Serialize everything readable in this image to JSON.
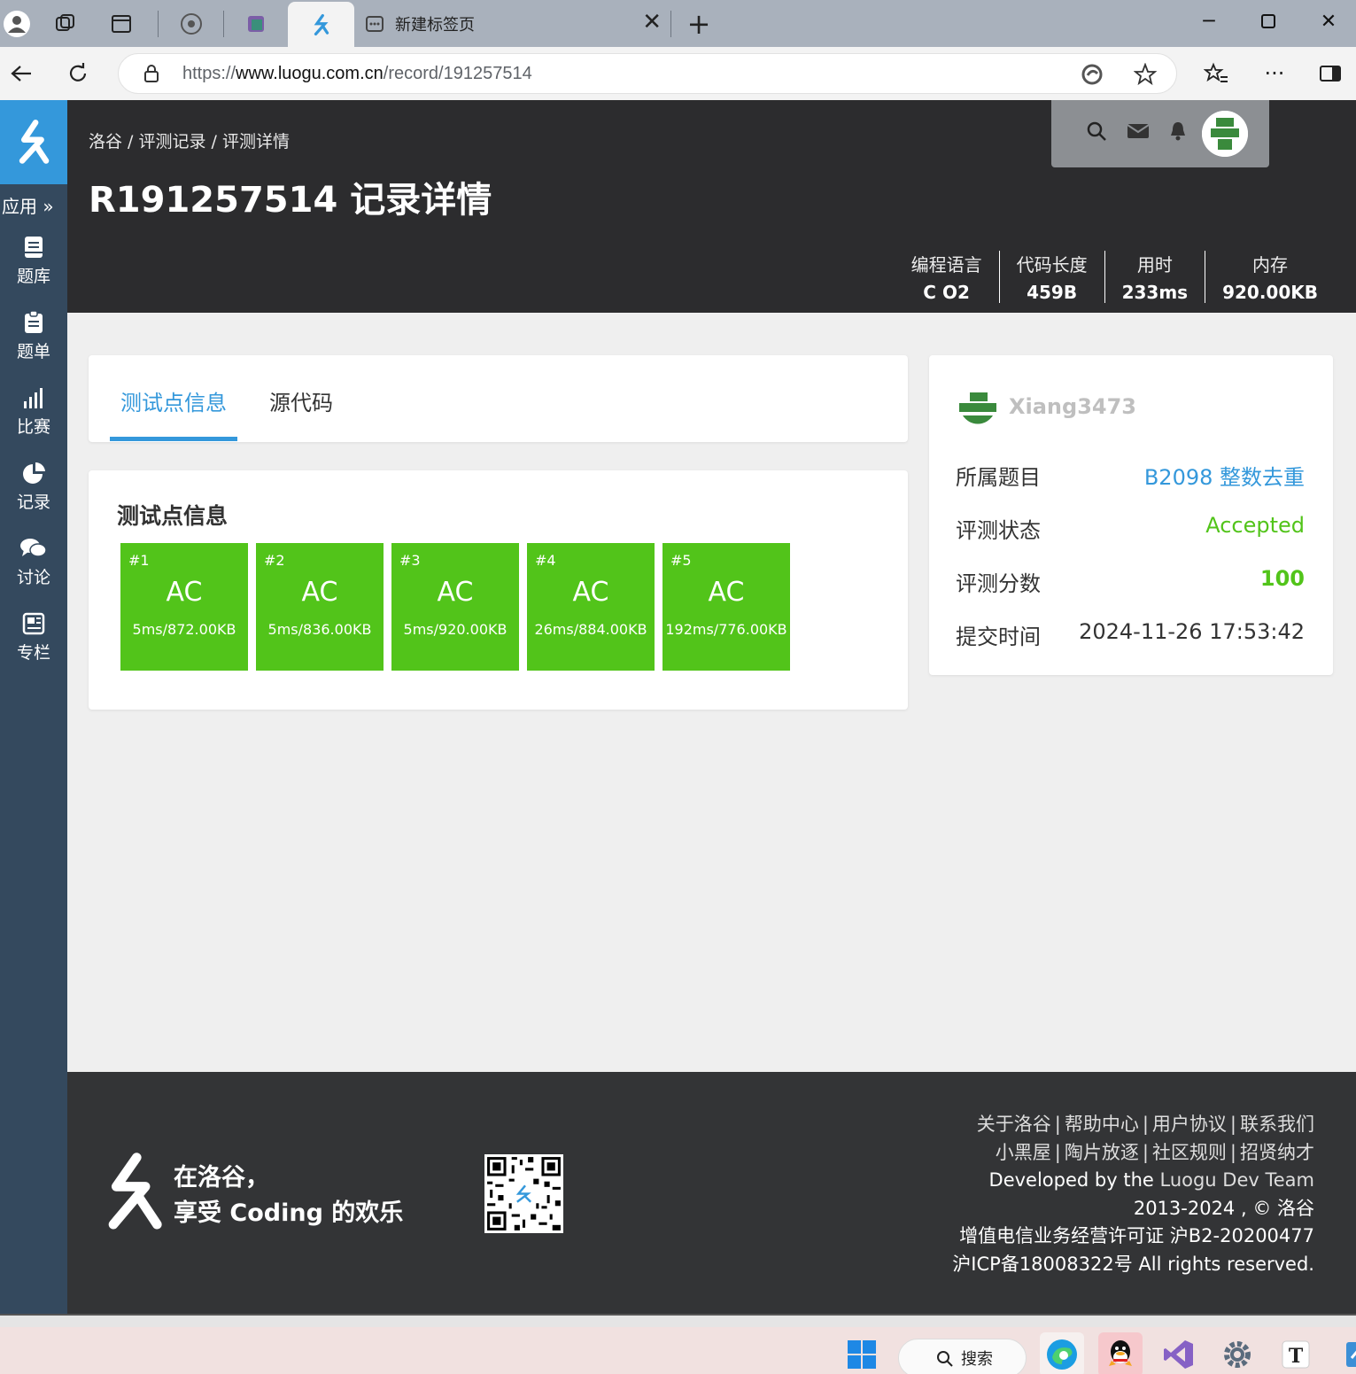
{
  "browser": {
    "tabs": [
      {
        "title": ""
      },
      {
        "title": "新建标签页"
      }
    ],
    "url_prefix": "https://",
    "url_host": "www.luogu.com.cn",
    "url_path": "/record/191257514"
  },
  "sidebar": {
    "apps_label": "应用",
    "items": [
      {
        "label": "题库",
        "icon": "book-icon"
      },
      {
        "label": "题单",
        "icon": "clipboard-icon"
      },
      {
        "label": "比赛",
        "icon": "bar-chart-icon"
      },
      {
        "label": "记录",
        "icon": "pie-chart-icon"
      },
      {
        "label": "讨论",
        "icon": "comments-icon"
      },
      {
        "label": "专栏",
        "icon": "newspaper-icon"
      }
    ]
  },
  "header": {
    "breadcrumb": "洛谷 / 评测记录 / 评测详情",
    "title": "R191257514 记录详情",
    "stats": [
      {
        "label": "编程语言",
        "value": "C O2"
      },
      {
        "label": "代码长度",
        "value": "459B"
      },
      {
        "label": "用时",
        "value": "233ms"
      },
      {
        "label": "内存",
        "value": "920.00KB"
      }
    ]
  },
  "tabs": {
    "active": "测试点信息",
    "inactive": "源代码"
  },
  "testcases": {
    "title": "测试点信息",
    "items": [
      {
        "num": "#1",
        "status": "AC",
        "result": "5ms/872.00KB"
      },
      {
        "num": "#2",
        "status": "AC",
        "result": "5ms/836.00KB"
      },
      {
        "num": "#3",
        "status": "AC",
        "result": "5ms/920.00KB"
      },
      {
        "num": "#4",
        "status": "AC",
        "result": "26ms/884.00KB"
      },
      {
        "num": "#5",
        "status": "AC",
        "result": "192ms/776.00KB"
      }
    ]
  },
  "info": {
    "username": "Xiang3473",
    "problem_label": "所属题目",
    "problem_value": "B2098 整数去重",
    "status_label": "评测状态",
    "status_value": "Accepted",
    "score_label": "评测分数",
    "score_value": "100",
    "time_label": "提交时间",
    "time_value": "2024-11-26 17:53:42"
  },
  "footer": {
    "slogan_line1": "在洛谷，",
    "slogan_line2": "享受 Coding 的欢乐",
    "links_row1": [
      "关于洛谷",
      "帮助中心",
      "用户协议",
      "联系我们"
    ],
    "links_row2": [
      "小黑屋",
      "陶片放逐",
      "社区规则",
      "招贤纳才"
    ],
    "dev_prefix": "Developed by the ",
    "dev_team": "Luogu Dev Team",
    "copyright": "2013-2024 , © 洛谷",
    "license": "增值电信业务经营许可证 沪B2-20200477",
    "icp": "沪ICP备18008322号 All rights reserved."
  },
  "taskbar": {
    "search_label": "搜索"
  },
  "colors": {
    "accent": "#3498db",
    "ac_green": "#52c41a",
    "sidebar": "#34495e",
    "header": "#2c2c2e"
  }
}
